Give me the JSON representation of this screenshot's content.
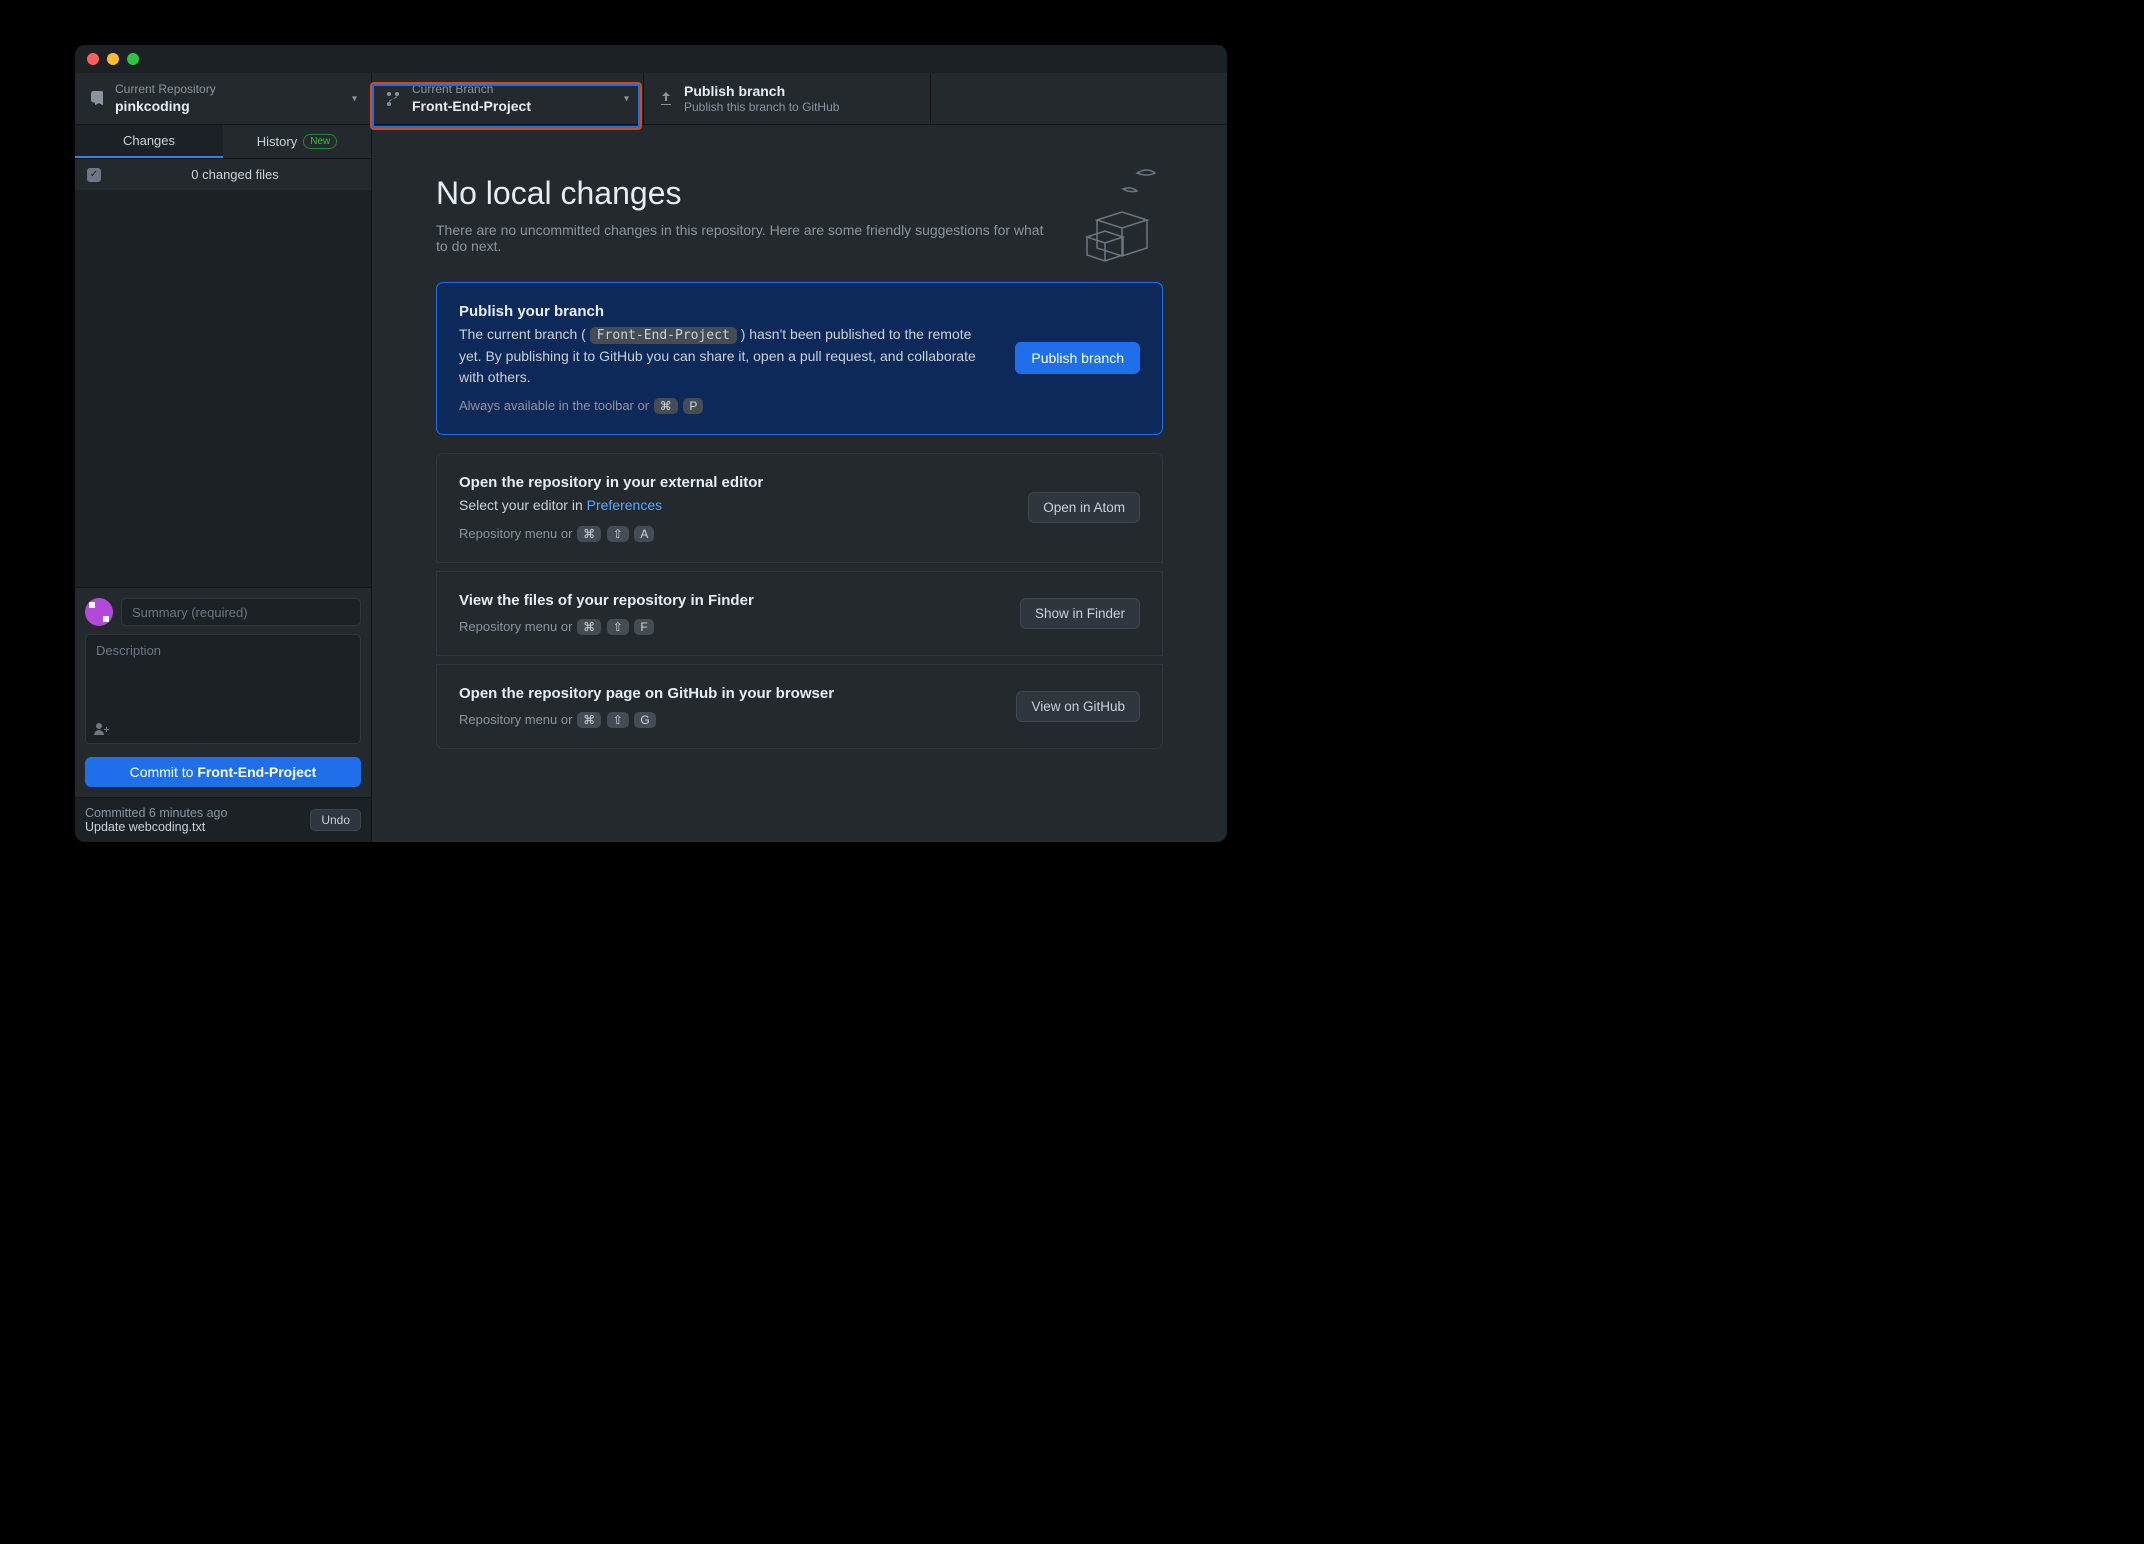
{
  "toolbar": {
    "repo": {
      "label": "Current Repository",
      "value": "pinkcoding"
    },
    "branch": {
      "label": "Current Branch",
      "value": "Front-End-Project"
    },
    "publish": {
      "label": "Publish branch",
      "desc": "Publish this branch to GitHub"
    }
  },
  "tabs": {
    "changes": "Changes",
    "history": "History",
    "new_badge": "New"
  },
  "changes_header": "0 changed files",
  "commit": {
    "summary_placeholder": "Summary (required)",
    "description_placeholder": "Description",
    "button_prefix": "Commit to ",
    "button_branch": "Front-End-Project"
  },
  "undo": {
    "line1": "Committed 6 minutes ago",
    "line2": "Update webcoding.txt",
    "button": "Undo"
  },
  "main": {
    "title": "No local changes",
    "subtitle": "There are no uncommitted changes in this repository. Here are some friendly suggestions for what to do next."
  },
  "cards": {
    "publish": {
      "title": "Publish your branch",
      "pretext": "The current branch (",
      "branch_code": "Front-End-Project",
      "posttext": ") hasn't been published to the remote yet. By publishing it to GitHub you can share it, open a pull request, and collaborate with others.",
      "hint_prefix": "Always available in the toolbar or",
      "kbd1": "⌘",
      "kbd2": "P",
      "button": "Publish branch"
    },
    "editor": {
      "title": "Open the repository in your external editor",
      "text_prefix": "Select your editor in ",
      "link": "Preferences",
      "hint_prefix": "Repository menu or",
      "kbd1": "⌘",
      "kbd2": "⇧",
      "kbd3": "A",
      "button": "Open in Atom"
    },
    "finder": {
      "title": "View the files of your repository in Finder",
      "hint_prefix": "Repository menu or",
      "kbd1": "⌘",
      "kbd2": "⇧",
      "kbd3": "F",
      "button": "Show in Finder"
    },
    "github": {
      "title": "Open the repository page on GitHub in your browser",
      "hint_prefix": "Repository menu or",
      "kbd1": "⌘",
      "kbd2": "⇧",
      "kbd3": "G",
      "button": "View on GitHub"
    }
  }
}
